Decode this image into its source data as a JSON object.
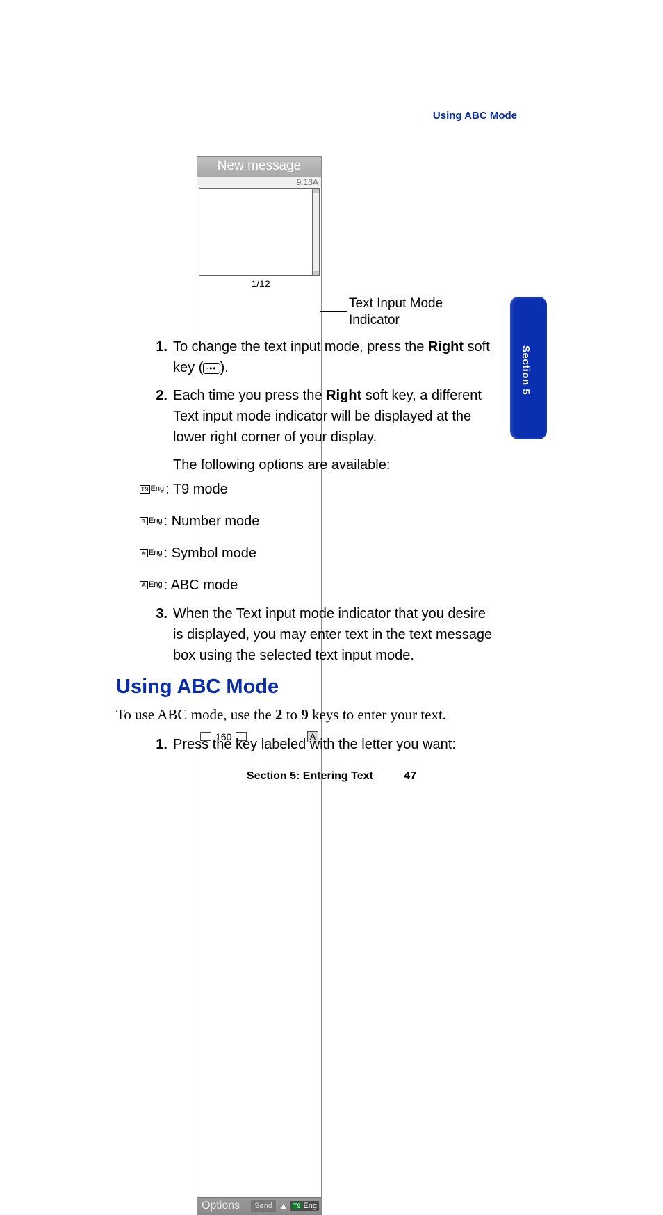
{
  "running_head": "Using ABC Mode",
  "phone": {
    "title": "New message",
    "time": "9:13A",
    "char_count": "160",
    "page_indicator": "1/12",
    "mode_letter": "A",
    "soft_left": "Options",
    "soft_mid": "Send",
    "soft_right_eng": "Eng"
  },
  "callout": "Text Input Mode Indicator",
  "steps": {
    "s1_num": "1.",
    "s1_a": "To change the text input mode, press the ",
    "s1_bold": "Right",
    "s1_b": " soft key (",
    "s1_c": ").",
    "s2_num": "2.",
    "s2_a": "Each time you press the ",
    "s2_bold": "Right",
    "s2_b": " soft key, a different Text input mode indicator will be displayed at the lower right corner of your display.",
    "s2_follow": "The following options are available:",
    "s3_num": "3.",
    "s3_body": "When the Text input mode indicator that you desire is displayed, you may enter text in the text message box using the selected text input mode."
  },
  "modes": {
    "t9_box": "T9",
    "t9_label": ": T9 mode",
    "num_box": "1",
    "num_label": ": Number mode",
    "sym_box": "#",
    "sym_label": ": Symbol mode",
    "abc_box": "A",
    "abc_label": ": ABC mode",
    "eng": "Eng"
  },
  "heading": "Using ABC Mode",
  "intro": {
    "a": "To use ABC mode, use the ",
    "b2": "2",
    "mid": " to ",
    "b9": "9",
    "c": " keys to enter your text."
  },
  "abc_step": {
    "num": "1.",
    "body": "Press the key labeled with the letter you want:"
  },
  "footer": {
    "section": "Section 5: Entering Text",
    "page": "47"
  },
  "tab": "Section 5",
  "softkey_dots": "⋅••"
}
